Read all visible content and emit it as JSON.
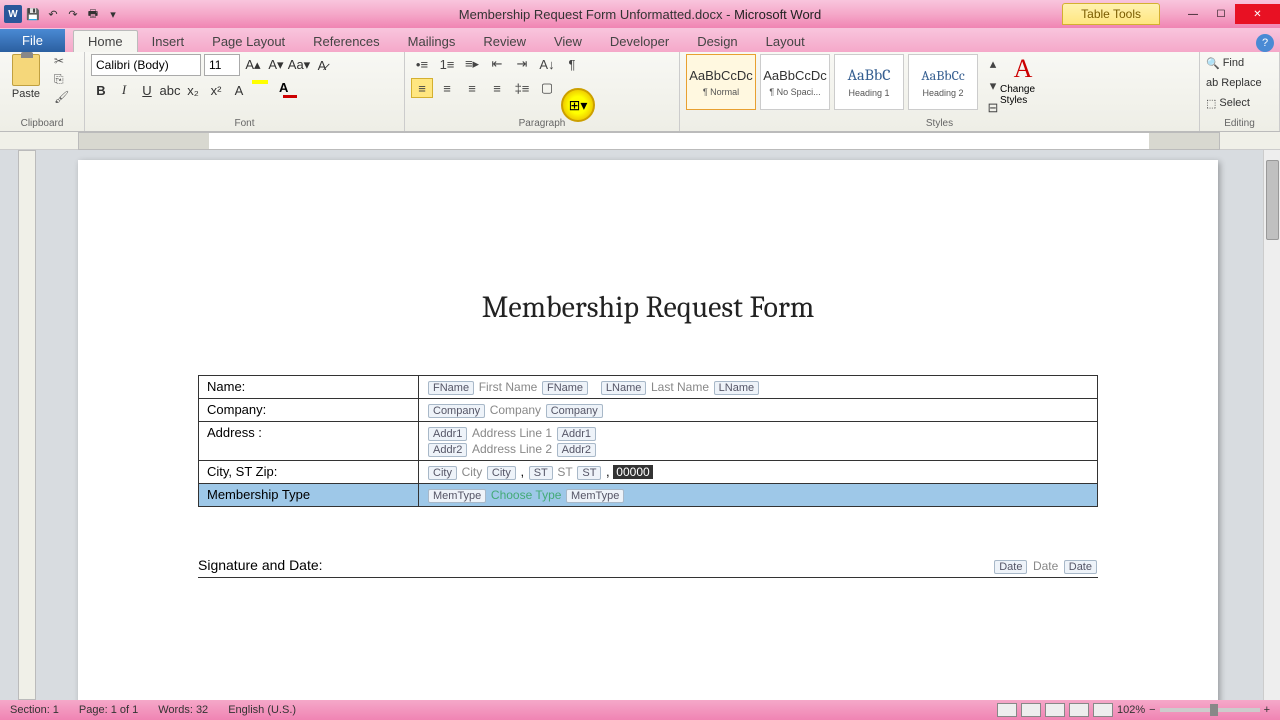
{
  "titlebar": {
    "doc_name": "Membership Request Form Unformatted.docx",
    "app_name": "Microsoft Word",
    "context_tab": "Table Tools"
  },
  "tabs": {
    "file": "File",
    "home": "Home",
    "insert": "Insert",
    "page_layout": "Page Layout",
    "references": "References",
    "mailings": "Mailings",
    "review": "Review",
    "view": "View",
    "developer": "Developer",
    "design": "Design",
    "layout": "Layout"
  },
  "ribbon": {
    "clipboard": {
      "label": "Clipboard",
      "paste": "Paste"
    },
    "font": {
      "label": "Font",
      "name": "Calibri (Body)",
      "size": "11"
    },
    "paragraph": {
      "label": "Paragraph"
    },
    "styles": {
      "label": "Styles",
      "items": [
        {
          "sample": "AaBbCcDc",
          "name": "¶ Normal"
        },
        {
          "sample": "AaBbCcDc",
          "name": "¶ No Spaci..."
        },
        {
          "sample": "AaBbC",
          "name": "Heading 1"
        },
        {
          "sample": "AaBbCc",
          "name": "Heading 2"
        }
      ],
      "change": "Change Styles"
    },
    "editing": {
      "label": "Editing",
      "find": "Find",
      "replace": "Replace",
      "select": "Select"
    }
  },
  "document": {
    "title": "Membership Request Form",
    "rows": {
      "name": {
        "label": "Name:",
        "tag1": "FName",
        "ph1": "First Name",
        "tag1b": "FName",
        "tag2": "LName",
        "ph2": "Last Name",
        "tag2b": "LName"
      },
      "company": {
        "label": "Company:",
        "tag": "Company",
        "ph": "Company",
        "tagb": "Company"
      },
      "address": {
        "label": "Address :",
        "tag1": "Addr1",
        "ph1": "Address Line 1",
        "tag1b": "Addr1",
        "tag2": "Addr2",
        "ph2": "Address Line 2",
        "tag2b": "Addr2"
      },
      "csz": {
        "label": "City, ST Zip:",
        "cityTag": "City",
        "cityPh": "City",
        "cityTagb": "City",
        "stTag": "ST",
        "stPh": "ST",
        "stTagb": "ST",
        "zip": "00000",
        "comma": ",",
        "comma2": ","
      },
      "memtype": {
        "label": "Membership Type",
        "tag": "MemType",
        "ph": "Choose Type",
        "tagb": "MemType"
      }
    },
    "signature": {
      "label": "Signature and Date:",
      "dateTag": "Date",
      "datePh": "Date",
      "dateTagb": "Date"
    }
  },
  "statusbar": {
    "section": "Section: 1",
    "page": "Page: 1 of 1",
    "words": "Words: 32",
    "lang": "English (U.S.)",
    "zoom": "102%"
  }
}
